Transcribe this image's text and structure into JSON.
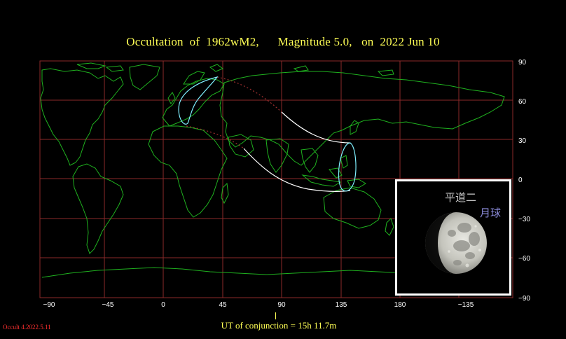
{
  "title": "Occultation  of  1962wM2,      Magnitude 5.0,   on  2022 Jun 10",
  "map": {
    "lat_labels": [
      "90",
      "60",
      "30",
      "0",
      "−30",
      "−60",
      "−90"
    ],
    "lon_labels": [
      "−90",
      "−45",
      "0",
      "45",
      "90",
      "135",
      "180",
      "−135"
    ],
    "colors": {
      "grid": "#8b2a2a",
      "coast": "#1fb11f",
      "track": "#ffffff",
      "limit": "#7ff0ff",
      "dotted": "#a03030"
    }
  },
  "conjunction_label": "UT of conjunction = 15h 11.7m",
  "version": "Occult 4.2022.5.11",
  "moon_panel": {
    "phase_label": "平道二",
    "moon_label": "月球"
  }
}
